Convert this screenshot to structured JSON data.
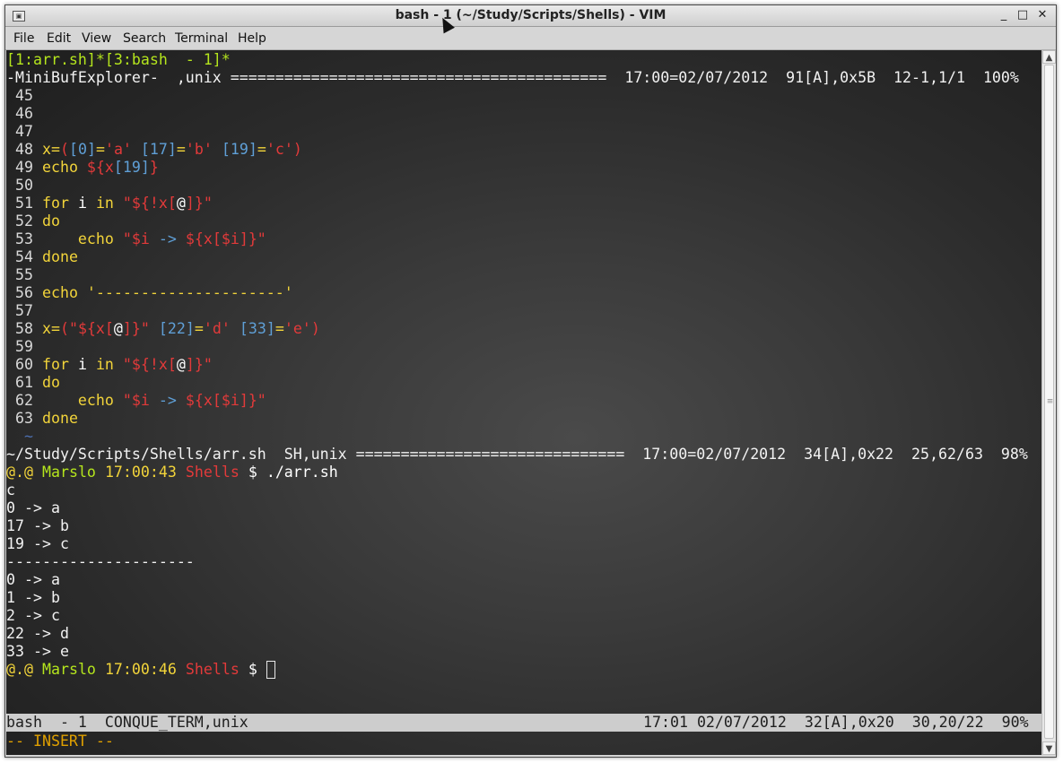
{
  "window": {
    "title": "bash  - 1 (~/Study/Scripts/Shells) - VIM",
    "minimize": "_",
    "maximize": "□",
    "close": "✕"
  },
  "menu": [
    "File",
    "Edit",
    "View",
    "Search",
    "Terminal",
    "Help"
  ],
  "tabline": "[1:arr.sh]*[3:bash  - 1]*",
  "minibuf_status": "-MiniBufExplorer-  ,unix ==========================================  17:00=02/07/2012  91[A],0x5B  12-1,1/1  100%",
  "code_lines": {
    "l45": " 45",
    "l46": " 46",
    "l47": " 47",
    "l48n": " 48 ",
    "l48a": "x=",
    "l48b": "(",
    "l48c": "[",
    "l48d": "0",
    "l48e": "]",
    "l48f": "=",
    "l48g": "'a'",
    "l48h": " [",
    "l48i": "17",
    "l48j": "]",
    "l48k": "=",
    "l48l": "'b'",
    "l48m": " [",
    "l48o": "19",
    "l48p": "]",
    "l48q": "=",
    "l48r": "'c'",
    "l48s": ")",
    "l49n": " 49 ",
    "l49a": "echo ",
    "l49b": "${x",
    "l49c": "[",
    "l49d": "19",
    "l49e": "]",
    "l49f": "}",
    "l50": " 50",
    "l51n": " 51 ",
    "l51a": "for",
    "l51b": " i ",
    "l51c": "in",
    "l51d": " \"${!x",
    "l51e": "[",
    "l51f": "@",
    "l51g": "]",
    "l51h": "}\"",
    "l52n": " 52 ",
    "l52a": "do",
    "l53n": " 53 ",
    "l53a": "    echo ",
    "l53b": "\"$i",
    "l53c": " -> ",
    "l53d": "${x",
    "l53e": "[",
    "l53f": "$i",
    "l53g": "]",
    "l53h": "}\"",
    "l54n": " 54 ",
    "l54a": "done",
    "l55": " 55",
    "l56n": " 56 ",
    "l56a": "echo ",
    "l56b": "'---------------------'",
    "l57": " 57",
    "l58n": " 58 ",
    "l58a": "x=",
    "l58b": "(",
    "l58c": "\"${x",
    "l58d": "[",
    "l58e": "@",
    "l58f": "]",
    "l58g": "}\"",
    "l58h": " [",
    "l58i": "22",
    "l58j": "]",
    "l58k": "=",
    "l58l": "'d'",
    "l58m": " [",
    "l58o": "33",
    "l58p": "]",
    "l58q": "=",
    "l58r": "'e'",
    "l58s": ")",
    "l59": " 59",
    "l60n": " 60 ",
    "l60a": "for",
    "l60b": " i ",
    "l60c": "in",
    "l60d": " \"${!x",
    "l60e": "[",
    "l60f": "@",
    "l60g": "]",
    "l60h": "}\"",
    "l61n": " 61 ",
    "l61a": "do",
    "l62n": " 62 ",
    "l62a": "    echo ",
    "l62b": "\"$i",
    "l62c": " -> ",
    "l62d": "${x",
    "l62e": "[",
    "l62f": "$i",
    "l62g": "]",
    "l62h": "}\"",
    "l63n": " 63 ",
    "l63a": "done",
    "tilde": "  ~"
  },
  "file_status": "~/Study/Scripts/Shells/arr.sh  SH,unix ==============================  17:00=02/07/2012  34[A],0x22  25,62/63  98%",
  "prompt1": {
    "at": "@.@",
    "user": "Marslo",
    "time": "17:00:43",
    "dir": "Shells",
    "sign": "$",
    "cmd": "./arr.sh"
  },
  "output": [
    "c",
    "0 -> a",
    "17 -> b",
    "19 -> c",
    "---------------------",
    "0 -> a",
    "1 -> b",
    "2 -> c",
    "22 -> d",
    "33 -> e"
  ],
  "prompt2": {
    "at": "@.@",
    "user": "Marslo",
    "time": "17:00:46",
    "dir": "Shells",
    "sign": "$"
  },
  "term_status": {
    "left": "bash  - 1  CONQUE_TERM,unix",
    "right": "17:01 02/07/2012  32[A],0x20  30,20/22  90%"
  },
  "mode": "-- INSERT --",
  "scrollbar": {
    "up": "▲",
    "down": "▼",
    "grip": "≡"
  }
}
